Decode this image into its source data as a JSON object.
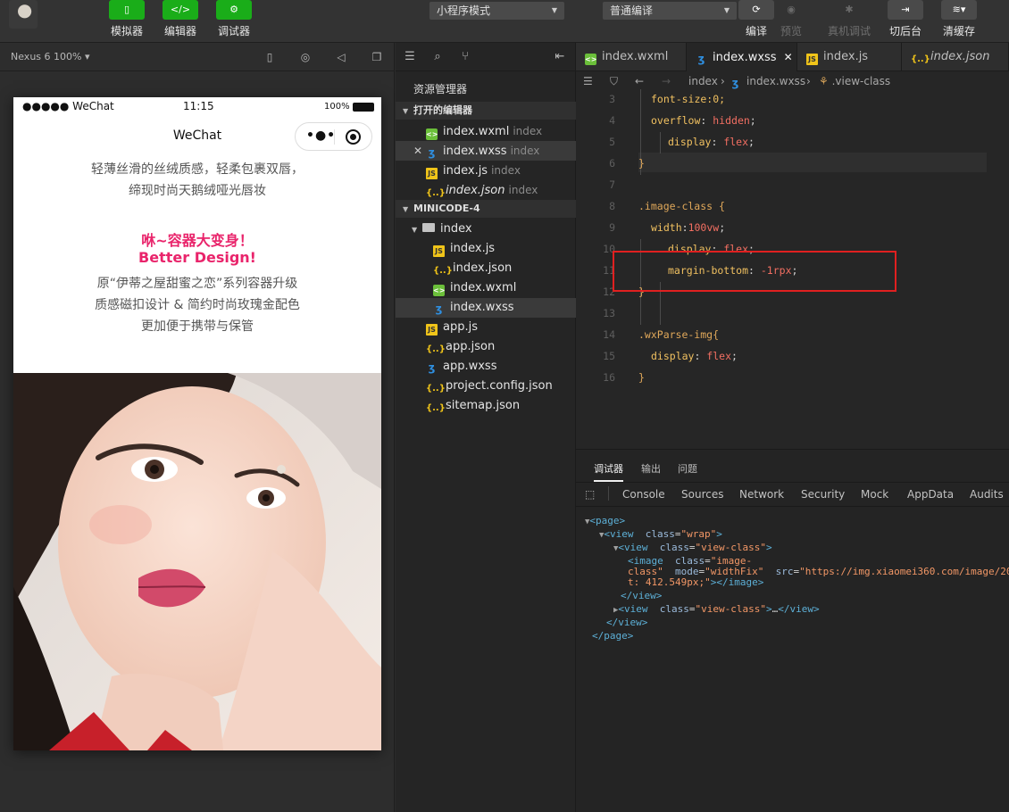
{
  "toolbar": {
    "buttons": [
      {
        "icon": "phone-icon",
        "label": "模拟器"
      },
      {
        "icon": "code-icon",
        "label": "编辑器"
      },
      {
        "icon": "sliders-icon",
        "label": "调试器"
      }
    ],
    "mode_select": "小程序模式",
    "compile_select": "普通编译",
    "right_buttons": [
      {
        "icon": "refresh-icon",
        "label": "编译"
      },
      {
        "icon": "eye-icon",
        "label": "预览"
      },
      {
        "icon": "bug-icon",
        "label": "真机调试"
      },
      {
        "icon": "switch-icon",
        "label": "切后台"
      },
      {
        "icon": "layers-icon",
        "label": "清缓存"
      }
    ]
  },
  "simulator": {
    "device": "Nexus 6 100%",
    "status": {
      "carrier": "●●●●● WeChat",
      "time": "11:15",
      "battery": "100%"
    },
    "nav_title": "WeChat",
    "copy": [
      "轻薄丝滑的丝绒质感，轻柔包裹双唇，",
      "缔现时尚天鹅绒哑光唇妆",
      "咻~容器大变身！",
      "Better Design!",
      "原“伊蒂之屋甜蜜之恋”系列容器升级",
      "质感磁扣设计 & 简约时尚玫瑰金配色",
      "更加便于携带与保管"
    ]
  },
  "explorer": {
    "title": "资源管理器",
    "open_editors_label": "打开的编辑器",
    "open_editors": [
      {
        "name": "index.wxml",
        "hint": "index",
        "type": "wxml"
      },
      {
        "name": "index.wxss",
        "hint": "index",
        "type": "wxss"
      },
      {
        "name": "index.js",
        "hint": "index",
        "type": "js"
      },
      {
        "name": "index.json",
        "hint": "index",
        "type": "json"
      }
    ],
    "project_label": "MINICODE-4",
    "folder": "index",
    "folder_files": [
      {
        "name": "index.js",
        "type": "js"
      },
      {
        "name": "index.json",
        "type": "json"
      },
      {
        "name": "index.wxml",
        "type": "wxml"
      },
      {
        "name": "index.wxss",
        "type": "wxss"
      }
    ],
    "root_files": [
      {
        "name": "app.js",
        "type": "js"
      },
      {
        "name": "app.json",
        "type": "json"
      },
      {
        "name": "app.wxss",
        "type": "wxss"
      },
      {
        "name": "project.config.json",
        "type": "json"
      },
      {
        "name": "sitemap.json",
        "type": "json"
      }
    ]
  },
  "editor": {
    "tabs": [
      {
        "name": "index.wxml",
        "type": "wxml"
      },
      {
        "name": "index.wxss",
        "type": "wxss"
      },
      {
        "name": "index.js",
        "type": "js"
      },
      {
        "name": "index.json",
        "type": "json"
      }
    ],
    "breadcrumb": [
      "index",
      "index.wxss",
      ".view-class"
    ],
    "lines": [
      {
        "n": "3",
        "text": "font-size:0;"
      },
      {
        "n": "4",
        "text": "overflow: hidden;"
      },
      {
        "n": "5",
        "text": "display: flex;"
      },
      {
        "n": "6",
        "text": "}"
      },
      {
        "n": "7",
        "text": ""
      },
      {
        "n": "8",
        "text": ".image-class {"
      },
      {
        "n": "9",
        "text": "width:100vw;"
      },
      {
        "n": "10",
        "text": "display: flex;"
      },
      {
        "n": "11",
        "text": "margin-bottom: -1rpx;"
      },
      {
        "n": "12",
        "text": "}"
      },
      {
        "n": "13",
        "text": ""
      },
      {
        "n": "14",
        "text": ".wxParse-img{"
      },
      {
        "n": "15",
        "text": "display: flex;"
      },
      {
        "n": "16",
        "text": "}"
      }
    ]
  },
  "devtools": {
    "top_tabs": [
      "调试器",
      "输出",
      "问题"
    ],
    "panels": [
      "Console",
      "Sources",
      "Network",
      "Security",
      "Mock",
      "AppData",
      "Audits"
    ],
    "dom": {
      "page": "<page>",
      "wrap": "<view  class=\"wrap\">",
      "view_class": "<view  class=\"view-class\">",
      "image_1": "<image  class=\"image-",
      "image_2": "class\"  mode=\"widthFix\"  src=\"https://img.xiaomei360.com/image/201",
      "image_3": "t: 412.549px;\"></image>",
      "close_view": "</view>",
      "collapsed_view": "<view  class=\"view-class\">…</view>",
      "close_view_2": "</view>",
      "close_page": "</page>"
    }
  },
  "colors": {
    "accent_green": "#1aad19",
    "highlight_red": "#e02020",
    "promo_pink": "#e9246b"
  }
}
